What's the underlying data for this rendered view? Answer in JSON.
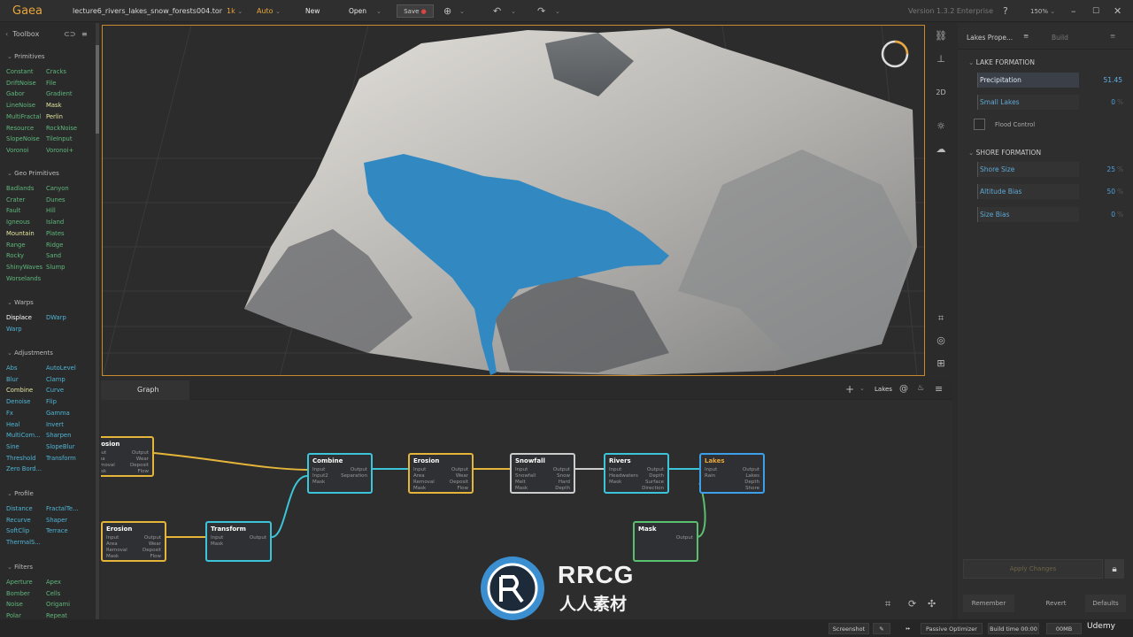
{
  "app": {
    "name": "Gaea",
    "file": "lecture6_rivers_lakes_snow_forests004.tor",
    "resolution": "1k",
    "mode": "Auto",
    "new": "New",
    "open": "Open",
    "save": "Save",
    "version": "Version 1.3.2 Enterprise",
    "zoom": "150%"
  },
  "toolbox": {
    "title": "Toolbox",
    "sections": [
      {
        "name": "Primitives",
        "items": [
          "Constant",
          "Cracks",
          "DriftNoise",
          "File",
          "Gabor",
          "Gradient",
          "LineNoise",
          "Mask",
          "MultiFractal",
          "Perlin",
          "Resource",
          "RockNoise",
          "SlopeNoise",
          "TileInput",
          "Voronoi",
          "Voronoi+"
        ]
      },
      {
        "name": "Geo Primitives",
        "items": [
          "Badlands",
          "Canyon",
          "Crater",
          "Dunes",
          "Fault",
          "Hill",
          "Igneous",
          "Island",
          "Mountain",
          "Plates",
          "Range",
          "Ridge",
          "Rocky",
          "Sand",
          "ShinyWaves",
          "Slump",
          "Worselands"
        ]
      },
      {
        "name": "Warps",
        "items": [
          "Displace",
          "DWarp",
          "Warp"
        ]
      },
      {
        "name": "Adjustments",
        "items": [
          "Abs",
          "AutoLevel",
          "Blur",
          "Clamp",
          "Combine",
          "Curve",
          "Denoise",
          "Flip",
          "Fx",
          "Gamma",
          "Heal",
          "Invert",
          "MultiCom...",
          "Sharpen",
          "Sine",
          "SlopeBlur",
          "Threshold",
          "Transform",
          "Zero Bord..."
        ]
      },
      {
        "name": "Profile",
        "items": [
          "Distance",
          "FractalTe...",
          "Recurve",
          "Shaper",
          "SoftClip",
          "Terrace",
          "ThermalS..."
        ]
      },
      {
        "name": "Filters",
        "items": [
          "Aperture",
          "Apex",
          "Bomber",
          "Cells",
          "Noise",
          "Origami",
          "Polar",
          "Repeat"
        ]
      }
    ]
  },
  "viewport": {
    "mode_2d": "2D"
  },
  "properties": {
    "tab": "Lakes Prope...",
    "tab2": "Build",
    "lake_section": "LAKE FORMATION",
    "precipitation_label": "Precipitation",
    "precipitation_value": "51.45",
    "small_lakes_label": "Small Lakes",
    "small_lakes_value": "0",
    "flood_label": "Flood Control",
    "shore_section": "SHORE FORMATION",
    "shore_size_label": "Shore Size",
    "shore_size_value": "25",
    "altitude_bias_label": "Altitude Bias",
    "altitude_bias_value": "50",
    "size_bias_label": "Size Bias",
    "size_bias_value": "0",
    "percent": "%",
    "apply": "Apply Changes",
    "remember": "Remember",
    "revert": "Revert",
    "defaults": "Defaults"
  },
  "graph": {
    "tab": "Graph",
    "current": "Lakes",
    "nodes": {
      "erosion1": {
        "title": "Erosion",
        "in": [
          "Input",
          "Area",
          "Removal",
          "Mask"
        ],
        "out": [
          "Output",
          "Wear",
          "Deposit",
          "Flow"
        ]
      },
      "combine": {
        "title": "Combine",
        "in": [
          "Input",
          "Input2",
          "Mask"
        ],
        "out": [
          "Output",
          "Separation"
        ]
      },
      "erosion2": {
        "title": "Erosion",
        "in": [
          "Input",
          "Area",
          "Removal",
          "Mask"
        ],
        "out": [
          "Output",
          "Wear",
          "Deposit",
          "Flow"
        ]
      },
      "snowfall": {
        "title": "Snowfall",
        "in": [
          "Input",
          "Snowfall",
          "Melt",
          "Mask"
        ],
        "out": [
          "Output",
          "Snow",
          "Hard",
          "Depth"
        ]
      },
      "rivers": {
        "title": "Rivers",
        "in": [
          "Input",
          "Headwaters",
          "Mask"
        ],
        "out": [
          "Output",
          "Depth",
          "Surface",
          "Direction"
        ]
      },
      "lakes": {
        "title": "Lakes",
        "in": [
          "Input",
          "Rain"
        ],
        "out": [
          "Output",
          "Lakes",
          "Depth",
          "Shore"
        ]
      },
      "erosion3": {
        "title": "Erosion",
        "in": [
          "Input",
          "Area",
          "Removal",
          "Mask"
        ],
        "out": [
          "Output",
          "Wear",
          "Deposit",
          "Flow"
        ]
      },
      "transform": {
        "title": "Transform",
        "in": [
          "Input",
          "Mask"
        ],
        "out": [
          "Output"
        ]
      },
      "mask": {
        "title": "Mask",
        "in": [],
        "out": [
          "Output"
        ]
      }
    }
  },
  "status": {
    "screenshot": "Screenshot",
    "optimizer": "Passive Optimizer",
    "build_time": "Build time 00:00",
    "mem": "00MB",
    "udemy": "Udemy"
  },
  "watermark": {
    "line1": "RRCG",
    "line2": "人人素材"
  }
}
